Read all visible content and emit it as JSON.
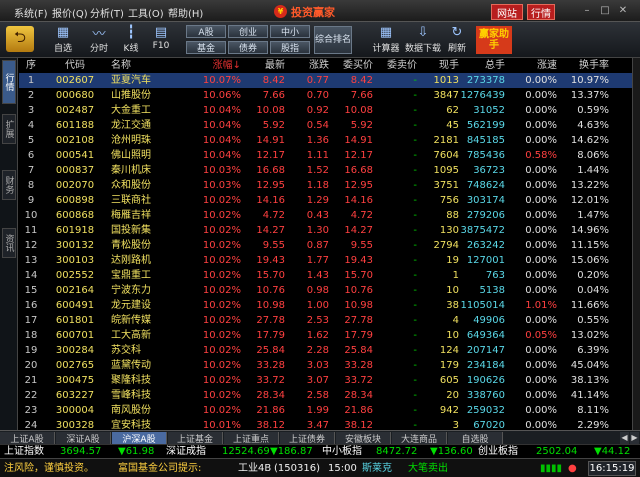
{
  "menu": {
    "items": [
      "系统(F)",
      "报价(Q)",
      "分析(T)",
      "工具(O)",
      "帮助(H)"
    ],
    "app_title": "投资赢家",
    "website_btn": "网站",
    "quote_btn": "行情"
  },
  "toolbar": {
    "back_icon": "back-arrow-icon",
    "buttons": [
      "自选",
      "分时",
      "K线",
      "F10"
    ],
    "market_buttons": [
      "A股",
      "创业",
      "中小",
      "基金",
      "债券",
      "股指"
    ],
    "combo_label": "综合排名",
    "calc": "计算器",
    "download": "数据下载",
    "refresh": "刷新",
    "promo": "赢家助手"
  },
  "sidebar": {
    "tabs": [
      "行情",
      "扩展",
      "财务",
      "资讯"
    ]
  },
  "table": {
    "headers": [
      "序",
      "代码",
      "名称",
      "涨幅↓",
      "最新",
      "涨跌",
      "委买价",
      "委卖价",
      "现手",
      "总手",
      "涨速",
      "换手率"
    ],
    "rows": [
      [
        "1",
        "002607",
        "亚夏汽车",
        "10.07%",
        "8.42",
        "0.77",
        "8.42",
        "-",
        "1013",
        "273378",
        "0.00%",
        "10.97%"
      ],
      [
        "2",
        "000680",
        "山推股份",
        "10.06%",
        "7.66",
        "0.70",
        "7.66",
        "-",
        "3847",
        "1276439",
        "0.00%",
        "13.37%"
      ],
      [
        "3",
        "002487",
        "大金重工",
        "10.04%",
        "10.08",
        "0.92",
        "10.08",
        "-",
        "62",
        "31052",
        "0.00%",
        "0.59%"
      ],
      [
        "4",
        "601188",
        "龙江交通",
        "10.04%",
        "5.92",
        "0.54",
        "5.92",
        "-",
        "45",
        "562199",
        "0.00%",
        "4.63%"
      ],
      [
        "5",
        "002108",
        "沧州明珠",
        "10.04%",
        "14.91",
        "1.36",
        "14.91",
        "-",
        "2181",
        "845185",
        "0.00%",
        "14.62%"
      ],
      [
        "6",
        "000541",
        "佛山照明",
        "10.04%",
        "12.17",
        "1.11",
        "12.17",
        "-",
        "7604",
        "785436",
        "0.58%",
        "8.06%"
      ],
      [
        "7",
        "000837",
        "秦川机床",
        "10.03%",
        "16.68",
        "1.52",
        "16.68",
        "-",
        "1095",
        "36723",
        "0.00%",
        "1.44%"
      ],
      [
        "8",
        "002070",
        "众和股份",
        "10.03%",
        "12.95",
        "1.18",
        "12.95",
        "-",
        "3751",
        "748624",
        "0.00%",
        "13.22%"
      ],
      [
        "9",
        "600898",
        "三联商社",
        "10.02%",
        "14.16",
        "1.29",
        "14.16",
        "-",
        "756",
        "303174",
        "0.00%",
        "12.01%"
      ],
      [
        "10",
        "600868",
        "梅雁吉祥",
        "10.02%",
        "4.72",
        "0.43",
        "4.72",
        "-",
        "88",
        "279206",
        "0.00%",
        "1.47%"
      ],
      [
        "11",
        "601918",
        "国投新集",
        "10.02%",
        "14.27",
        "1.30",
        "14.27",
        "-",
        "130",
        "3875472",
        "0.00%",
        "14.96%"
      ],
      [
        "12",
        "300132",
        "青松股份",
        "10.02%",
        "9.55",
        "0.87",
        "9.55",
        "-",
        "2794",
        "263242",
        "0.00%",
        "11.15%"
      ],
      [
        "13",
        "300103",
        "达刚路机",
        "10.02%",
        "19.43",
        "1.77",
        "19.43",
        "-",
        "19",
        "127001",
        "0.00%",
        "15.06%"
      ],
      [
        "14",
        "002552",
        "宝鼎重工",
        "10.02%",
        "15.70",
        "1.43",
        "15.70",
        "-",
        "1",
        "763",
        "0.00%",
        "0.20%"
      ],
      [
        "15",
        "002164",
        "宁波东力",
        "10.02%",
        "10.76",
        "0.98",
        "10.76",
        "-",
        "10",
        "5138",
        "0.00%",
        "0.04%"
      ],
      [
        "16",
        "600491",
        "龙元建设",
        "10.02%",
        "10.98",
        "1.00",
        "10.98",
        "-",
        "38",
        "1105014",
        "1.01%",
        "11.66%"
      ],
      [
        "17",
        "601801",
        "皖新传媒",
        "10.02%",
        "27.78",
        "2.53",
        "27.78",
        "-",
        "4",
        "49906",
        "0.00%",
        "0.55%"
      ],
      [
        "18",
        "600701",
        "工大高新",
        "10.02%",
        "17.79",
        "1.62",
        "17.79",
        "-",
        "10",
        "649364",
        "0.05%",
        "13.02%"
      ],
      [
        "19",
        "300284",
        "苏交科",
        "10.02%",
        "25.84",
        "2.28",
        "25.84",
        "-",
        "124",
        "207147",
        "0.00%",
        "6.39%"
      ],
      [
        "20",
        "002765",
        "蓝黛传动",
        "10.02%",
        "33.28",
        "3.03",
        "33.28",
        "-",
        "179",
        "234184",
        "0.00%",
        "45.04%"
      ],
      [
        "21",
        "300475",
        "聚隆科技",
        "10.02%",
        "33.72",
        "3.07",
        "33.72",
        "-",
        "605",
        "190626",
        "0.00%",
        "38.13%"
      ],
      [
        "22",
        "603227",
        "雪峰科技",
        "10.02%",
        "28.34",
        "2.58",
        "28.34",
        "-",
        "20",
        "338760",
        "0.00%",
        "41.14%"
      ],
      [
        "23",
        "300004",
        "南风股份",
        "10.02%",
        "21.86",
        "1.99",
        "21.86",
        "-",
        "942",
        "259032",
        "0.00%",
        "8.11%"
      ],
      [
        "24",
        "300328",
        "宜安科技",
        "10.01%",
        "38.12",
        "3.47",
        "38.12",
        "-",
        "3",
        "67020",
        "0.00%",
        "2.29%"
      ]
    ],
    "red_speed_rows": [
      5,
      15,
      17
    ]
  },
  "bottom_tabs": [
    "上证A股",
    "深证A股",
    "沪深A股",
    "上证基金",
    "上证重点",
    "上证债券",
    "安徽板块",
    "大连商品",
    "自选股"
  ],
  "index_bar": {
    "sh_name": "上证指数",
    "sh_val": "3694.57",
    "sh_chg": "▼61.98",
    "sz_name": "深证成指",
    "sz_val": "12524.69",
    "sz_chg": "▼186.87",
    "zx_name": "中小板指",
    "zx_val": "8472.72",
    "zx_chg": "▼136.60",
    "cy_name": "创业板指",
    "cy_val": "2502.04",
    "cy_chg": "▼44.12"
  },
  "status": {
    "risk": "注风险，谨慎投资。",
    "notice": "富国基金公司提示:",
    "stock1": "工业4B",
    "code1": "(150316)",
    "time1": "15:00",
    "stock2": "斯莱克",
    "msg2": "大笔卖出",
    "clock": "16:15:19"
  },
  "colors": {
    "up": "#ff4040",
    "down": "#00d000",
    "code": "#f0e060",
    "total": "#5ad8e8",
    "selected_row": "#1e3a72"
  }
}
